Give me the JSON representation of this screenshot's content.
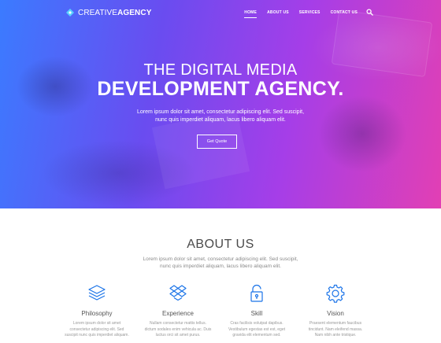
{
  "brand": {
    "name_light": "CREATIVE",
    "name_bold": "AGENCY"
  },
  "nav": {
    "items": [
      {
        "label": "HOME",
        "active": true
      },
      {
        "label": "ABOUT US",
        "active": false
      },
      {
        "label": "SERVICES",
        "active": false
      },
      {
        "label": "CONTACT US",
        "active": false
      }
    ],
    "search_icon": "search-icon"
  },
  "hero": {
    "title_line1": "THE DIGITAL MEDIA",
    "title_line2": "DEVELOPMENT AGENCY.",
    "subtitle_line1": "Lorem ipsum dolor sit amet, consectetur adipiscing elit. Sed suscipit,",
    "subtitle_line2": "nunc quis imperdiet aliquam, lacus libero aliquam elit.",
    "cta_label": "Get Quote",
    "gradient_colors": [
      "#3b7bff",
      "#6a4cf0",
      "#a53ee8",
      "#e23fb4"
    ]
  },
  "about": {
    "title": "ABOUT US",
    "text_line1": "Lorem ipsum dolor sit amet, consectetur adipiscing elit. Sed suscipit,",
    "text_line2": "nunc quis imperdiet aliquam, lacus libero aliquam elit.",
    "accent_color": "#1a73e8",
    "features": [
      {
        "icon": "stack-icon",
        "title": "Philosophy",
        "desc_line1": "Lorem ipsum dolor sit amet",
        "desc_line2": "consectetur adipiscing elit. Sed",
        "desc_line3": "suscipit nunc quis imperdiet aliquam."
      },
      {
        "icon": "dropbox-icon",
        "title": "Experience",
        "desc_line1": "Nullam consectetur mattis tellus.",
        "desc_line2": "dictum sodales enim vehicula ac. Duis",
        "desc_line3": "luctus orci sit amet purus."
      },
      {
        "icon": "unlock-icon",
        "title": "Skill",
        "desc_line1": "Cras facilisis volutpat dapibus.",
        "desc_line2": "Vestibulum egestas est est, eget",
        "desc_line3": "gravida elit elementum sed."
      },
      {
        "icon": "gear-icon",
        "title": "Vision",
        "desc_line1": "Praesent elementum faucibus",
        "desc_line2": "tincidunt. Nam eleifend massa.",
        "desc_line3": "Nam nibh ante tristique."
      }
    ]
  }
}
